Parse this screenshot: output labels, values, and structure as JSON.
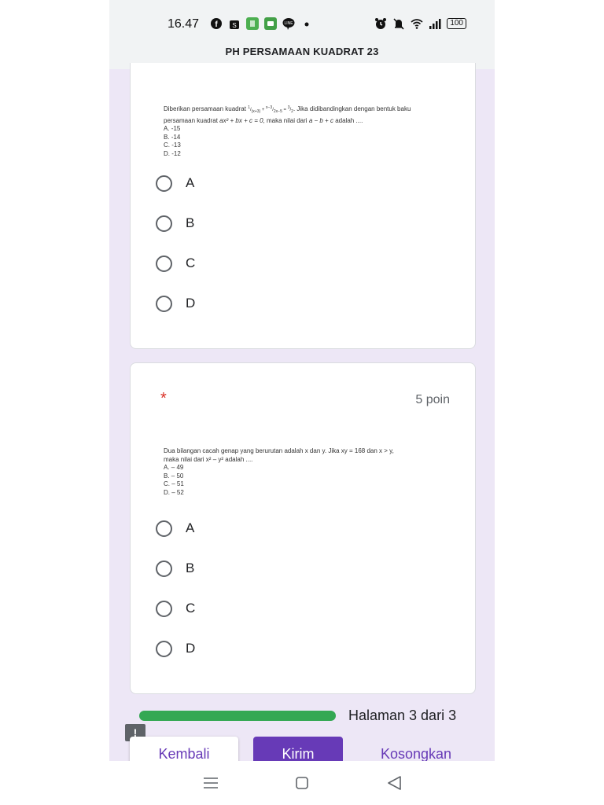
{
  "status_bar": {
    "time": "16.47",
    "battery": "100",
    "left_icons": [
      "facebook-icon",
      "shopee-icon",
      "app-icon",
      "messages-icon",
      "line-icon",
      "dot-icon"
    ],
    "right_icons": [
      "alarm-icon",
      "mute-icon",
      "wifi-icon",
      "signal-icon",
      "battery-icon"
    ]
  },
  "form": {
    "title": "PH PERSAMAAN KUADRAT 23"
  },
  "question1": {
    "line1_prefix": "Diberikan persamaan kuadrat",
    "line1_suffix": ". Jika didibandingkan dengan bentuk baku",
    "line2_prefix": "persamaan kuadrat",
    "line2_middle": ", maka nilai dari",
    "line2_suffix": "adalah ....",
    "choices": [
      "A. -15",
      "B. -14",
      "C. -13",
      "D. -12"
    ],
    "options": [
      "A",
      "B",
      "C",
      "D"
    ]
  },
  "question2": {
    "required_mark": "*",
    "points": "5 poin",
    "line1": "Dua bilangan cacah genap yang berurutan adalah x dan y. Jika xy = 168 dan x > y,",
    "line2": "maka nilai dari x² – y²  adalah ....",
    "choices": [
      "A. – 49",
      "B.  – 50",
      "C. – 51",
      "D. – 52"
    ],
    "options": [
      "A",
      "B",
      "C",
      "D"
    ]
  },
  "footer": {
    "progress_label": "Halaman 3 dari 3",
    "progress_fraction": 1.0,
    "back_label": "Kembali",
    "submit_label": "Kirim",
    "clear_label": "Kosongkan",
    "report_label": "!"
  },
  "colors": {
    "accent": "#673ab7",
    "progress": "#34a853",
    "background": "#ede7f6",
    "required": "#d93025"
  }
}
